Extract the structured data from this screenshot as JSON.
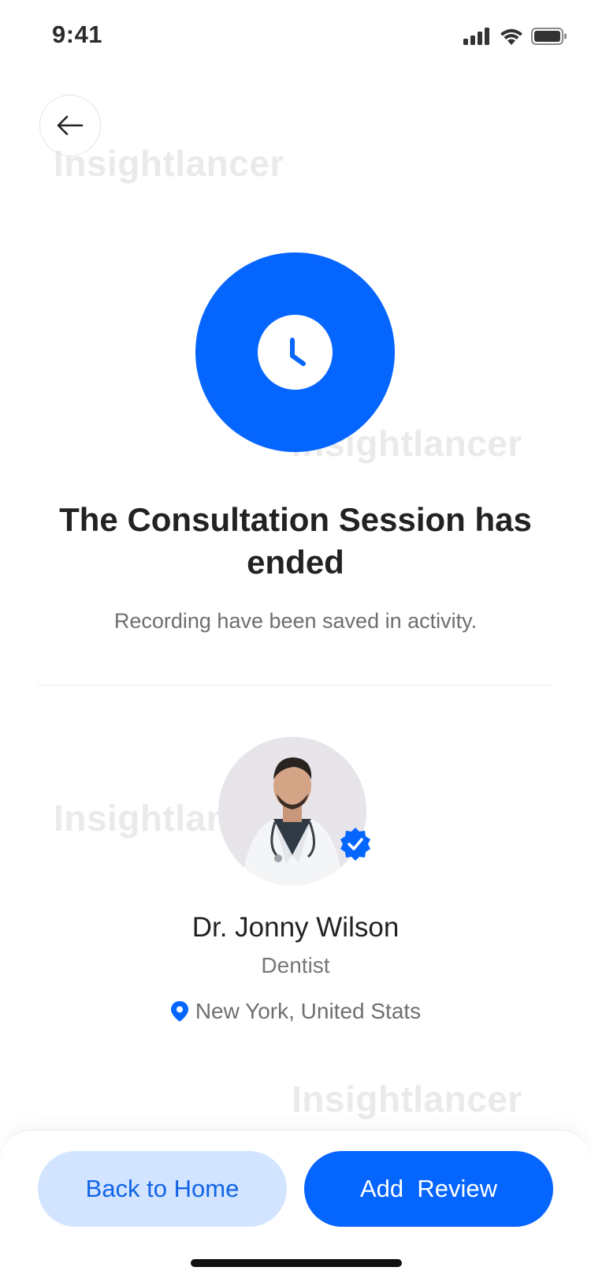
{
  "status_bar": {
    "time": "9:41",
    "icons": [
      "cellular-signal-icon",
      "wifi-icon",
      "battery-icon"
    ]
  },
  "nav": {
    "back_icon": "arrow-left-icon"
  },
  "watermarks": [
    "Insightlancer",
    "Insightlancer",
    "Insightlancer",
    "Insightlancer"
  ],
  "hero": {
    "icon": "clock-icon",
    "accent_color": "#0565ff"
  },
  "message": {
    "title": "The Consultation Session has ended",
    "subtitle": "Recording have been saved in activity."
  },
  "doctor": {
    "name": "Dr. Jonny Wilson",
    "specialty": "Dentist",
    "location": "New York, United Stats",
    "verified_icon": "verified-badge-icon",
    "location_icon": "location-pin-icon"
  },
  "actions": {
    "back_home_label": "Back to Home",
    "add_review_label": "Add  Review"
  },
  "colors": {
    "primary": "#0565ff",
    "primary_light": "#d2e4ff",
    "text_dark": "#222222",
    "text_muted": "#6e6e6e"
  }
}
